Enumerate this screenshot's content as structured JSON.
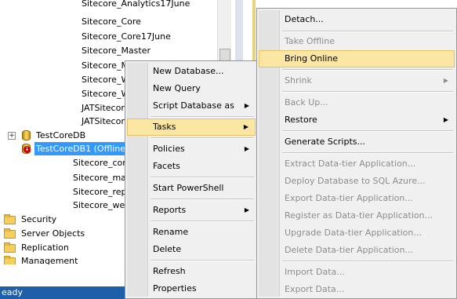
{
  "tree": {
    "items": [
      {
        "label": "Sitecore_Analytics17June"
      },
      {
        "label": "Sitecore_Core"
      },
      {
        "label": "Sitecore_Core17June"
      },
      {
        "label": "Sitecore_Master"
      },
      {
        "label": "Sitecore_Ma"
      },
      {
        "label": "Sitecore_W"
      },
      {
        "label": "Sitecore_W"
      },
      {
        "label": "JATSitecor"
      },
      {
        "label": "JATSitecor"
      }
    ],
    "db1": "TestCoreDB",
    "db2": "TestCoreDB1 (Offline",
    "db2_children": [
      {
        "label": "Sitecore_core"
      },
      {
        "label": "Sitecore_mas"
      },
      {
        "label": "Sitecore_repo"
      },
      {
        "label": "Sitecore_web"
      }
    ],
    "folders": [
      {
        "label": "Security"
      },
      {
        "label": "Server Objects"
      },
      {
        "label": "Replication"
      },
      {
        "label": "Management"
      }
    ]
  },
  "status": {
    "text": "eady"
  },
  "context_menu": {
    "items": [
      {
        "label": "New Database..."
      },
      {
        "label": "New Query"
      },
      {
        "label": "Script Database as",
        "arrow": "▶"
      },
      {
        "label": "Tasks",
        "arrow": "▶"
      },
      {
        "label": "Policies",
        "arrow": "▶"
      },
      {
        "label": "Facets"
      },
      {
        "label": "Start PowerShell"
      },
      {
        "label": "Reports",
        "arrow": "▶"
      },
      {
        "label": "Rename"
      },
      {
        "label": "Delete"
      },
      {
        "label": "Refresh"
      },
      {
        "label": "Properties"
      }
    ]
  },
  "tasks_menu": {
    "items": [
      {
        "label": "Detach..."
      },
      {
        "label": "Take Offline"
      },
      {
        "label": "Bring Online"
      },
      {
        "label": "Shrink",
        "arrow": "▶"
      },
      {
        "label": "Back Up..."
      },
      {
        "label": "Restore",
        "arrow": "▶"
      },
      {
        "label": "Generate Scripts..."
      },
      {
        "label": "Extract Data-tier Application..."
      },
      {
        "label": "Deploy Database to SQL Azure..."
      },
      {
        "label": "Export Data-tier Application..."
      },
      {
        "label": "Register as Data-tier Application..."
      },
      {
        "label": "Upgrade Data-tier Application..."
      },
      {
        "label": "Delete Data-tier Application..."
      },
      {
        "label": "Import Data..."
      },
      {
        "label": "Export Data..."
      }
    ]
  }
}
